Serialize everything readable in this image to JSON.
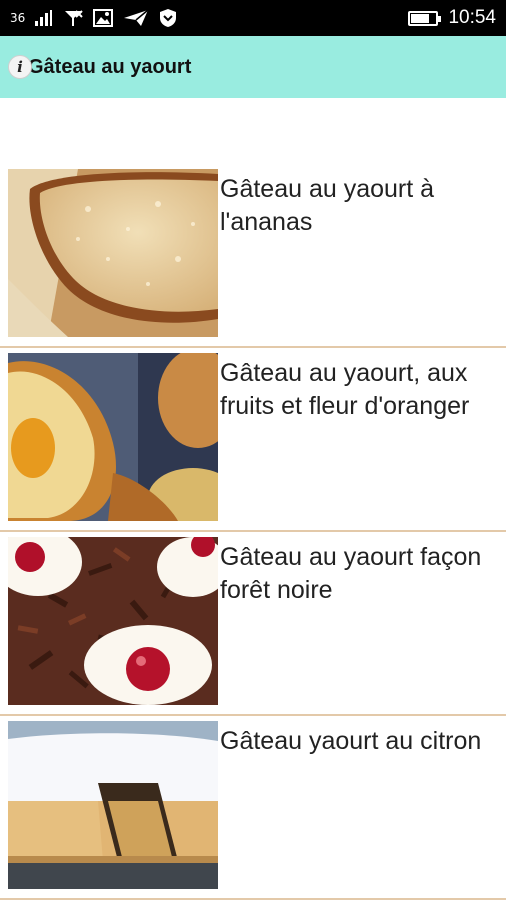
{
  "status_bar": {
    "signal_label": "36",
    "time": "10:54",
    "battery_level": 0.75
  },
  "app_bar": {
    "title": "Gâteau au yaourt",
    "info_icon": "info-icon"
  },
  "recipes": [
    {
      "title": "Gâteau au yaourt à l'ananas",
      "image": "pineapple-yogurt-cake"
    },
    {
      "title": "Gâteau au yaourt, aux fruits et fleur d'oranger",
      "image": "madeleine-apricot"
    },
    {
      "title": "Gâteau au yaourt façon forêt noire",
      "image": "black-forest-cherry"
    },
    {
      "title": "Gâteau yaourt au citron",
      "image": "lemon-iced-cake"
    }
  ],
  "colors": {
    "app_bar": "#99ece0",
    "divider": "#e3c9a9",
    "status_bar": "#000000"
  }
}
